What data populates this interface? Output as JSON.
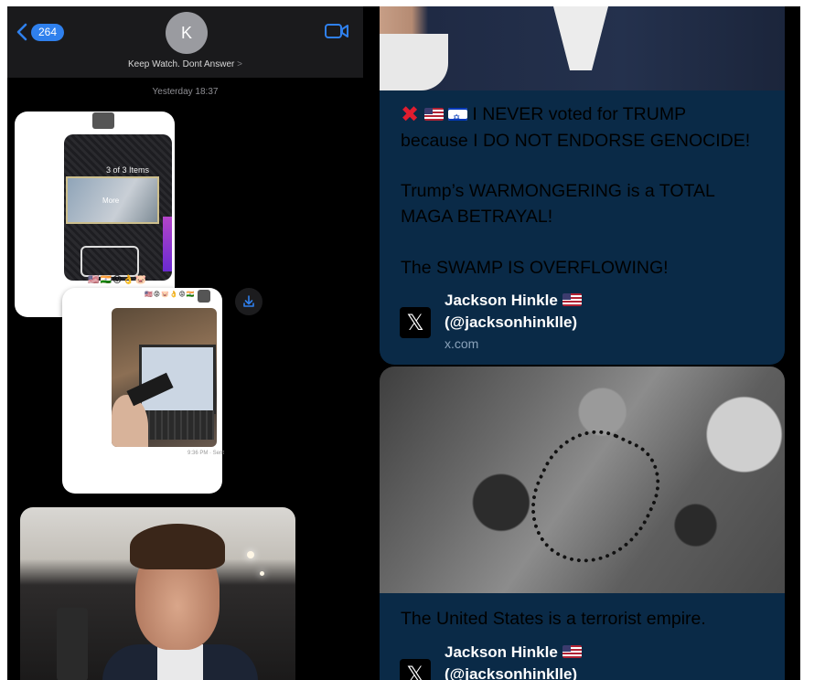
{
  "messages": {
    "back_count": "264",
    "contact_initial": "K",
    "contact_name": "Keep Watch. Dont Answer",
    "contact_chevron": ">",
    "timestamp": "Yesterday 18:37",
    "icons": {
      "back": "chevron-left-icon",
      "video": "video-camera-icon",
      "save": "download-icon"
    },
    "attachment1": {
      "items_label": "3 of 3 Items",
      "more_label": "More",
      "emoji_row": "🇺🇸🇮🇳😡👌🐷"
    },
    "attachment2": {
      "emoji_row": "🇺🇸😡🐷👌😡🇮🇳",
      "sent_label": "9:36 PM · Sent"
    }
  },
  "feed": {
    "tweet1": {
      "line1_rest": " I NEVER voted for TRUMP",
      "line2": "because I DO NOT ENDORSE GENOCIDE!",
      "line3": "Trump’s WARMONGERING is a TOTAL",
      "line4": "MAGA BETRAYAL!",
      "line5": "The SWAMP IS OVERFLOWING!",
      "author_name": "Jackson Hinkle",
      "author_handle": "(@jacksonhinklle)",
      "domain": "x.com"
    },
    "tweet2": {
      "text": "The United States is a terrorist empire.",
      "author_name": "Jackson Hinkle",
      "author_handle": "(@jacksonhinklle)"
    },
    "logo_glyph": "𝕏",
    "cross_glyph": "✖",
    "colors": {
      "card_bg": "#0a2a47",
      "accent_blue": "#2f80ed",
      "cross_red": "#e11d2f"
    }
  }
}
